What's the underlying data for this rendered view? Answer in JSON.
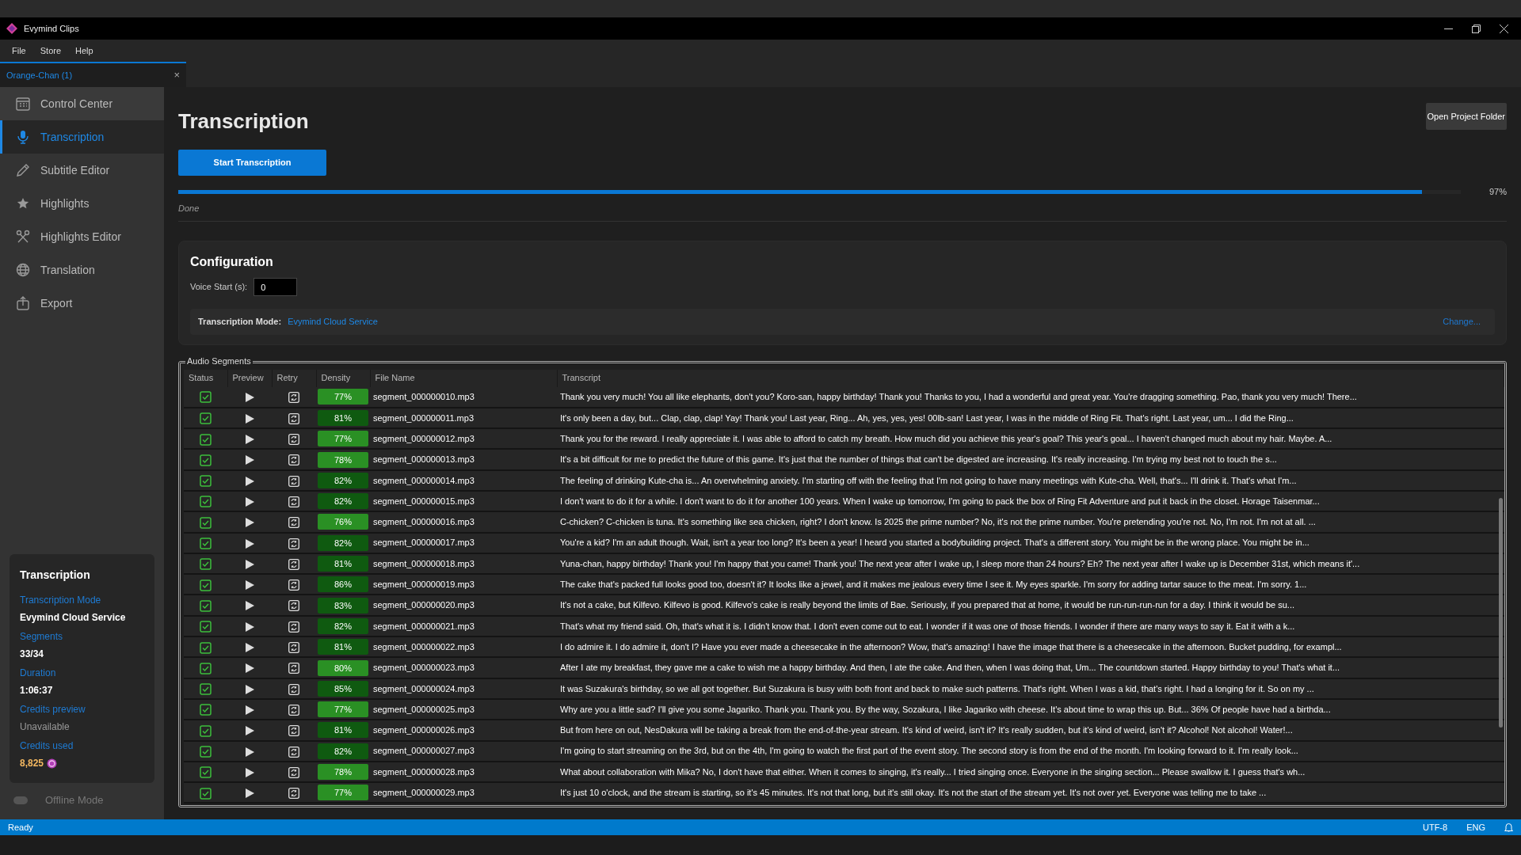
{
  "window": {
    "title": "Evymind Clips"
  },
  "menu_bar": [
    "File",
    "Store",
    "Help"
  ],
  "document_tab": {
    "label": "Orange-Chan (1)",
    "close": "×"
  },
  "sidebar": {
    "items": [
      {
        "label": "Control Center",
        "selected": false
      },
      {
        "label": "Transcription",
        "selected": true
      },
      {
        "label": "Subtitle Editor",
        "selected": false
      },
      {
        "label": "Highlights",
        "selected": false
      },
      {
        "label": "Highlights Editor",
        "selected": false
      },
      {
        "label": "Translation",
        "selected": false
      },
      {
        "label": "Export",
        "selected": false
      }
    ]
  },
  "summary": {
    "title": "Transcription",
    "fields": [
      {
        "label": "Transcription Mode",
        "value": "Evymind Cloud Service",
        "kind": "text"
      },
      {
        "label": "Segments",
        "value": "33/34",
        "kind": "text"
      },
      {
        "label": "Duration",
        "value": "1:06:37",
        "kind": "text"
      },
      {
        "label": "Credits preview",
        "value": "Unavailable",
        "kind": "muted"
      },
      {
        "label": "Credits used",
        "value": "8,825",
        "kind": "credits"
      }
    ]
  },
  "offline_mode": {
    "label": "Offline Mode",
    "on": false
  },
  "page": {
    "title": "Transcription",
    "start_button": "Start Transcription",
    "open_folder_button": "Open Project Folder",
    "progress": {
      "level": 0.97,
      "reading": "97%"
    },
    "status": "Done"
  },
  "configuration": {
    "title": "Configuration",
    "voice_start": {
      "label": "Voice Start (s):",
      "value": "0"
    },
    "mode": {
      "label": "Transcription Mode:",
      "value": "Evymind Cloud Service",
      "change_link": "Change..."
    }
  },
  "audio_segments": {
    "title": "Audio Segments",
    "columns": [
      "Status",
      "Preview",
      "Retry",
      "Density",
      "File Name",
      "Transcript"
    ],
    "rows": [
      {
        "checked": true,
        "density": {
          "text": "77%",
          "color": "#2a9024"
        },
        "file_name": "segment_000000010.mp3",
        "transcript": "Thank you very much! You all like elephants, don't you? Koro-san, happy birthday! Thank you! Thanks to you, I had a wonderful and great year. You're dragging something. Pao, thank you very much! There..."
      },
      {
        "checked": true,
        "density": {
          "text": "81%",
          "color": "#0f5a10"
        },
        "file_name": "segment_000000011.mp3",
        "transcript": "It's only been a day, but... Clap, clap, clap! Yay! Thank you! Last year, Ring... Ah, yes, yes, yes! 00lb-san! Last year, I was in the middle of Ring Fit. That's right. Last year, um... I did the Ring..."
      },
      {
        "checked": true,
        "density": {
          "text": "77%",
          "color": "#2a9024"
        },
        "file_name": "segment_000000012.mp3",
        "transcript": "Thank you for the reward. I really appreciate it. I was able to afford to catch my breath. How much did you achieve this year's goal? This year's goal... I haven't changed much about my hair. Maybe. A..."
      },
      {
        "checked": true,
        "density": {
          "text": "78%",
          "color": "#2a9024"
        },
        "file_name": "segment_000000013.mp3",
        "transcript": "It's a bit difficult for me to predict the future of this game. It's just that the number of things that can't be digested are increasing. It's really increasing. I'm trying my best not to touch the s..."
      },
      {
        "checked": true,
        "density": {
          "text": "82%",
          "color": "#0f5a10"
        },
        "file_name": "segment_000000014.mp3",
        "transcript": "The feeling of drinking Kute-cha is... An overwhelming anxiety. I'm starting off with the feeling that I'm not going to have many meetings with Kute-cha. Well, that's... I'll drink it. That's what I'm..."
      },
      {
        "checked": true,
        "density": {
          "text": "82%",
          "color": "#0f5a10"
        },
        "file_name": "segment_000000015.mp3",
        "transcript": "I don't want to do it for a while. I don't want to do it for another 100 years. When I wake up tomorrow, I'm going to pack the box of Ring Fit Adventure and put it back in the closet. Horage Taisenmar..."
      },
      {
        "checked": true,
        "density": {
          "text": "76%",
          "color": "#2a9024"
        },
        "file_name": "segment_000000016.mp3",
        "transcript": "C-chicken? C-chicken is tuna. It's something like sea chicken, right? I don't know. Is 2025 the prime number? No, it's not the prime number. You're pretending you're not. No, I'm not. I'm not at all. ..."
      },
      {
        "checked": true,
        "density": {
          "text": "82%",
          "color": "#0f5a10"
        },
        "file_name": "segment_000000017.mp3",
        "transcript": "You're a kid? I'm an adult though. Wait, isn't a year too long? It's been a year! I heard you started a bodybuilding project. That's a different story. You might be in the wrong place. You might be in..."
      },
      {
        "checked": true,
        "density": {
          "text": "81%",
          "color": "#0f5a10"
        },
        "file_name": "segment_000000018.mp3",
        "transcript": "Yuna-chan, happy birthday! Thank you! I'm happy that you came! Thank you! The next year after I wake up, I sleep more than 24 hours? Eh? The next year after I wake up is December 31st, which means it'..."
      },
      {
        "checked": true,
        "density": {
          "text": "86%",
          "color": "#0f5a10"
        },
        "file_name": "segment_000000019.mp3",
        "transcript": "The cake that's packed full looks good too, doesn't it? It looks like a jewel, and it makes me jealous every time I see it. My eyes sparkle. I'm sorry for adding tartar sauce to the meat. I'm sorry. 1..."
      },
      {
        "checked": true,
        "density": {
          "text": "83%",
          "color": "#0f5a10"
        },
        "file_name": "segment_000000020.mp3",
        "transcript": "It's not a cake, but Kilfevo. Kilfevo is good. Kilfevo's cake is really beyond the limits of Bae. Seriously, if you prepared that at home, it would be run-run-run-run for a day. I think it would be su..."
      },
      {
        "checked": true,
        "density": {
          "text": "82%",
          "color": "#0f5a10"
        },
        "file_name": "segment_000000021.mp3",
        "transcript": "That's what my friend said. Oh, that's what it is. I didn't know that. I don't even come out to eat. I wonder if it was one of those friends. I wonder if there are many ways to say it. Eat it with a k..."
      },
      {
        "checked": true,
        "density": {
          "text": "81%",
          "color": "#0f5a10"
        },
        "file_name": "segment_000000022.mp3",
        "transcript": "I do admire it. I do admire it, don't I? Have you ever made a cheesecake in the afternoon? Wow, that's amazing! I have the image that there is a cheesecake in the afternoon. Bucket pudding, for exampl..."
      },
      {
        "checked": true,
        "density": {
          "text": "80%",
          "color": "#2a9024"
        },
        "file_name": "segment_000000023.mp3",
        "transcript": "After I ate my breakfast, they gave me a cake to wish me a happy birthday. And then, I ate the cake. And then, when I was doing that, Um... The countdown started. Happy birthday to you! That's what it..."
      },
      {
        "checked": true,
        "density": {
          "text": "85%",
          "color": "#0f5a10"
        },
        "file_name": "segment_000000024.mp3",
        "transcript": "It was Suzakura's birthday, so we all got together. But Suzakura is busy with both front and back to make such patterns. That's right. When I was a kid, that's right. I had a longing for it. So on my ..."
      },
      {
        "checked": true,
        "density": {
          "text": "77%",
          "color": "#2a9024"
        },
        "file_name": "segment_000000025.mp3",
        "transcript": "Why are you a little sad? I'll give you some Jagariko. Thank you. Thank you. By the way, Sozakura, I like Jagariko with cheese. It's about time to wrap this up. But... 36% Of people have had a birthda..."
      },
      {
        "checked": true,
        "density": {
          "text": "81%",
          "color": "#0f5a10"
        },
        "file_name": "segment_000000026.mp3",
        "transcript": "But from here on out, NesDakura will be taking a break from the end-of-the-year stream. It's kind of weird, isn't it? It's really sudden, but it's kind of weird, isn't it? Alcohol! Not alcohol! Water!..."
      },
      {
        "checked": true,
        "density": {
          "text": "82%",
          "color": "#0f5a10"
        },
        "file_name": "segment_000000027.mp3",
        "transcript": "I'm going to start streaming on the 3rd, but on the 4th, I'm going to watch the first part of the event story. The second story is from the end of the month. I'm looking forward to it. I'm really look..."
      },
      {
        "checked": true,
        "density": {
          "text": "78%",
          "color": "#2a9024"
        },
        "file_name": "segment_000000028.mp3",
        "transcript": "What about collaboration with Mika? No, I don't have that either. When it comes to singing, it's really... I tried singing once. Everyone in the singing section... Please swallow it. I guess that's wh..."
      },
      {
        "checked": true,
        "density": {
          "text": "77%",
          "color": "#2a9024"
        },
        "file_name": "segment_000000029.mp3",
        "transcript": "It's just 10 o'clock, and the stream is starting, so it's 45 minutes. It's not that long, but it's still okay. It's not the start of the stream yet. It's not over yet. Everyone was telling me to take ..."
      }
    ]
  },
  "status_bar": {
    "text": "Ready",
    "encoding": "UTF-8",
    "language": "ENG"
  }
}
